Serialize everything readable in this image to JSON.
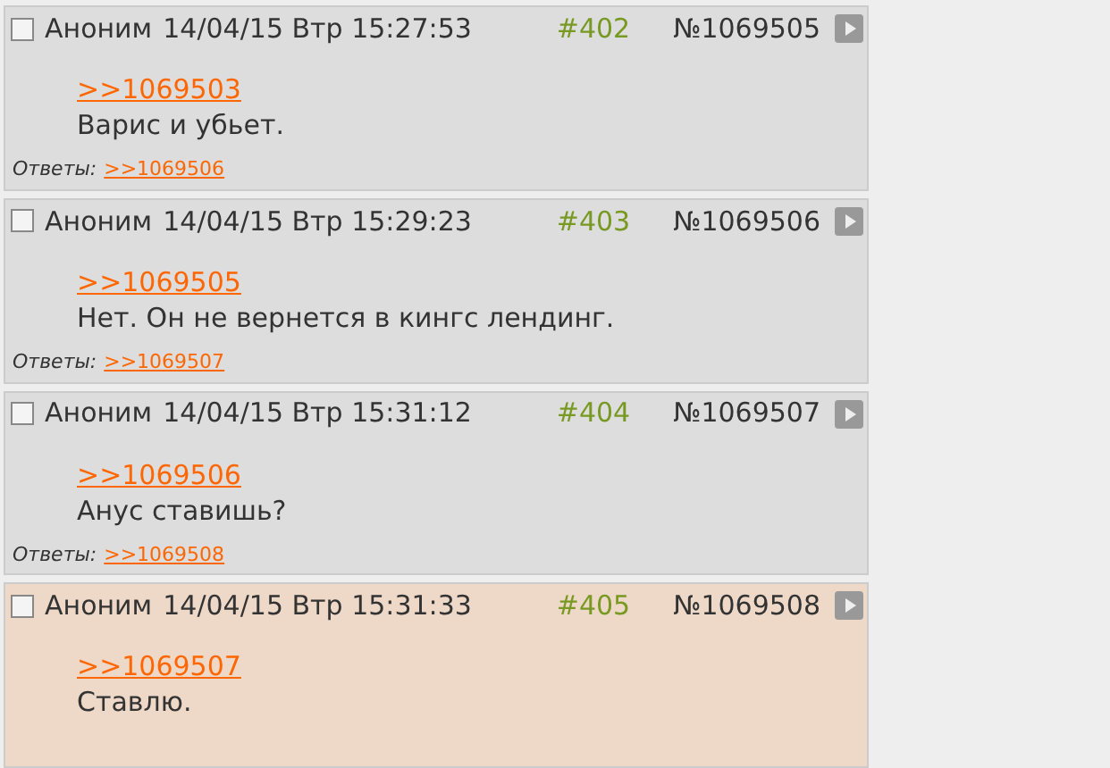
{
  "posts": [
    {
      "checked": false,
      "selected": false,
      "author": "Аноним",
      "date": "14/04/15 Втр 15:27:53",
      "number": "#402",
      "id": "№1069505",
      "reply_link": ">>1069503",
      "text": "Варис и убьет.",
      "replies_label": "Ответы:",
      "replies": [
        ">>1069506"
      ]
    },
    {
      "checked": false,
      "selected": false,
      "author": "Аноним",
      "date": "14/04/15 Втр 15:29:23",
      "number": "#403",
      "id": "№1069506",
      "reply_link": ">>1069505",
      "text": "Нет. Он не вернется в кингс лендинг.",
      "replies_label": "Ответы:",
      "replies": [
        ">>1069507"
      ]
    },
    {
      "checked": false,
      "selected": false,
      "author": "Аноним",
      "date": "14/04/15 Втр 15:31:12",
      "number": "#404",
      "id": "№1069507",
      "reply_link": ">>1069506",
      "text": "Анус ставишь?",
      "replies_label": "Ответы:",
      "replies": [
        ">>1069508"
      ]
    },
    {
      "checked": false,
      "selected": true,
      "author": "Аноним",
      "date": "14/04/15 Втр 15:31:33",
      "number": "#405",
      "id": "№1069508",
      "reply_link": ">>1069507",
      "text": "Ставлю."
    }
  ]
}
